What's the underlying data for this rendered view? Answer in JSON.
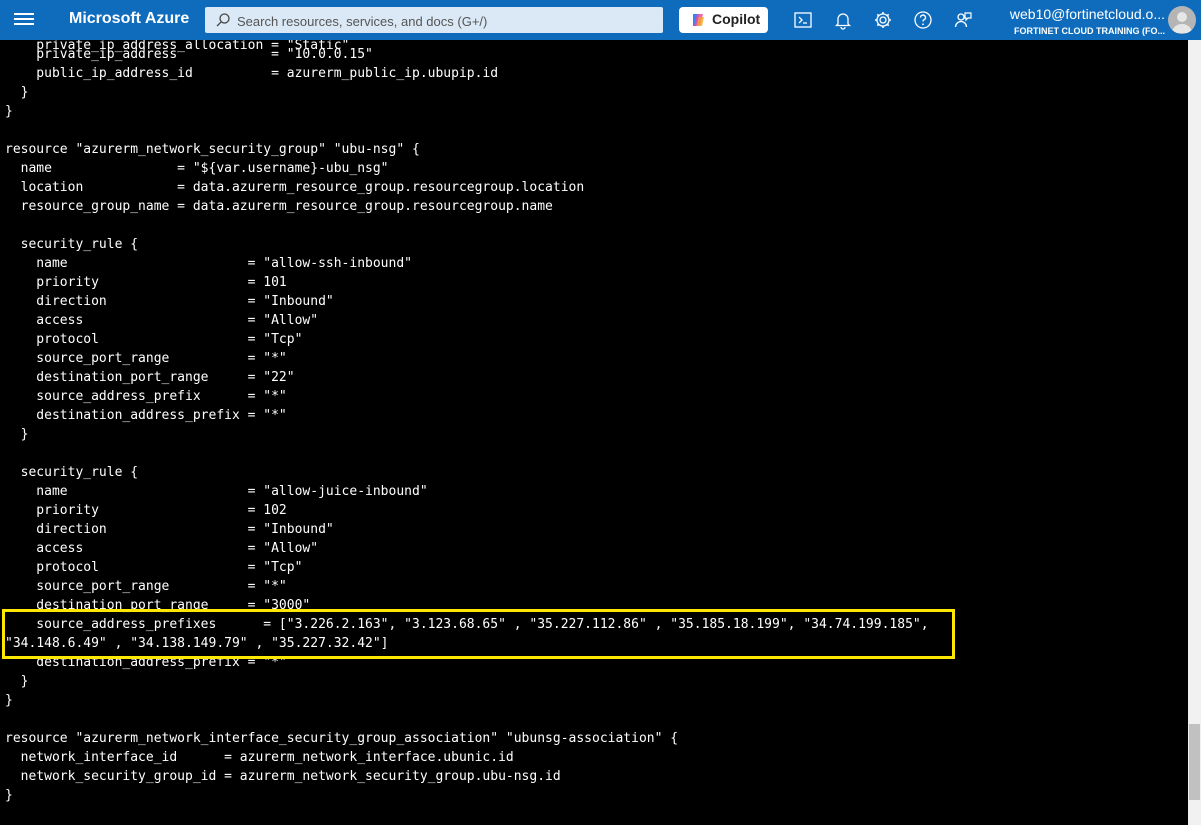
{
  "topbar": {
    "brand": "Microsoft Azure",
    "search_placeholder": "Search resources, services, and docs (G+/)",
    "copilot_label": "Copilot",
    "user": "web10@fortinetcloud.o...",
    "org": "FORTINET CLOUD TRAINING (FO..."
  },
  "terminal": {
    "lines": [
      "    private_ip_address_allocation = \"Static\"",
      "    private_ip_address            = \"10.0.0.15\"",
      "    public_ip_address_id          = azurerm_public_ip.ubupip.id",
      "  }",
      "}",
      "",
      "resource \"azurerm_network_security_group\" \"ubu-nsg\" {",
      "  name                = \"${var.username}-ubu_nsg\"",
      "  location            = data.azurerm_resource_group.resourcegroup.location",
      "  resource_group_name = data.azurerm_resource_group.resourcegroup.name",
      "",
      "  security_rule {",
      "    name                       = \"allow-ssh-inbound\"",
      "    priority                   = 101",
      "    direction                  = \"Inbound\"",
      "    access                     = \"Allow\"",
      "    protocol                   = \"Tcp\"",
      "    source_port_range          = \"*\"",
      "    destination_port_range     = \"22\"",
      "    source_address_prefix      = \"*\"",
      "    destination_address_prefix = \"*\"",
      "  }",
      "",
      "  security_rule {",
      "    name                       = \"allow-juice-inbound\"",
      "    priority                   = 102",
      "    direction                  = \"Inbound\"",
      "    access                     = \"Allow\"",
      "    protocol                   = \"Tcp\"",
      "    source_port_range          = \"*\"",
      "    destination_port_range     = \"3000\"",
      "    source_address_prefixes      = [\"3.226.2.163\", \"3.123.68.65\" , \"35.227.112.86\" , \"35.185.18.199\", \"34.74.199.185\",",
      "\"34.148.6.49\" , \"34.138.149.79\" , \"35.227.32.42\"]",
      "    destination_address_prefix = \"*\"",
      "  }",
      "}",
      "",
      "resource \"azurerm_network_interface_security_group_association\" \"ubunsg-association\" {",
      "  network_interface_id      = azurerm_network_interface.ubunic.id",
      "  network_security_group_id = azurerm_network_security_group.ubu-nsg.id",
      "}"
    ]
  },
  "colors": {
    "topbar_bg": "#0f6cbd",
    "terminal_bg": "#000000",
    "terminal_text": "#ffffff",
    "highlight": "#ffe800"
  }
}
